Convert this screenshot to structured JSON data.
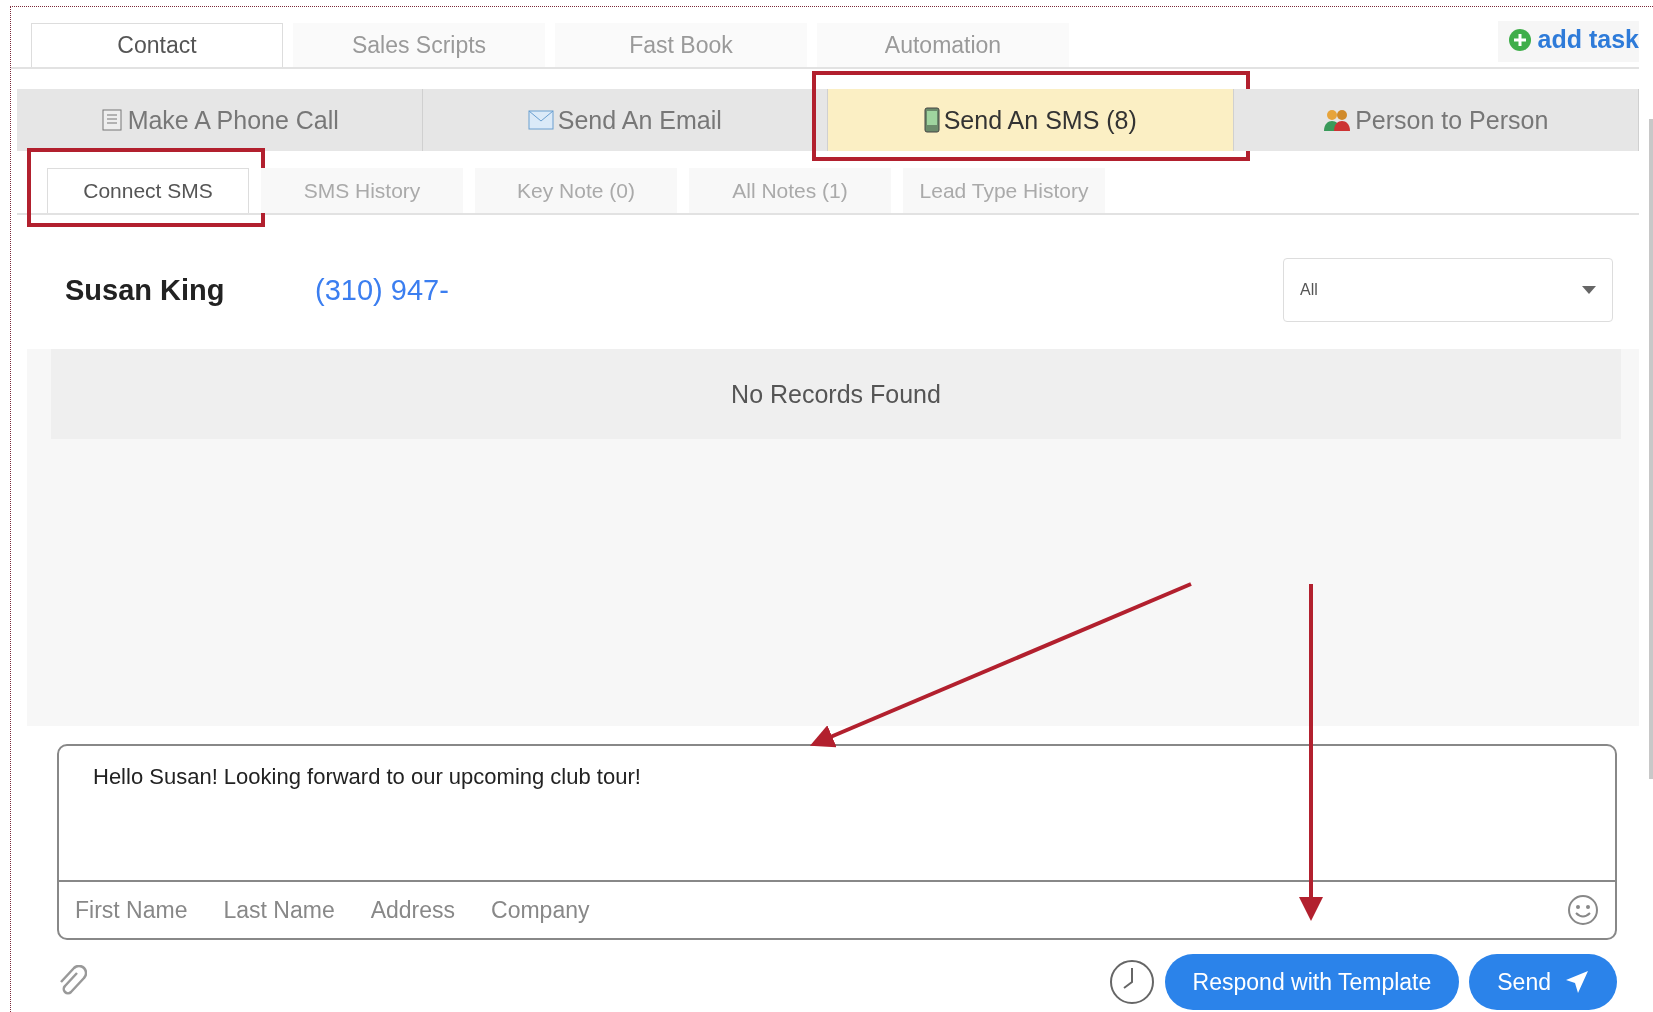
{
  "top_tabs": [
    {
      "label": "Contact",
      "selected": true
    },
    {
      "label": "Sales Scripts",
      "selected": false
    },
    {
      "label": "Fast Book",
      "selected": false
    },
    {
      "label": "Automation",
      "selected": false
    }
  ],
  "add_task": {
    "label": "add task"
  },
  "channel_tabs": [
    {
      "kind": "phone",
      "label": "Make A Phone Call",
      "selected": false,
      "annotated": false
    },
    {
      "kind": "email",
      "label": "Send An Email",
      "selected": false,
      "annotated": false
    },
    {
      "kind": "sms",
      "label": "Send An SMS (8)",
      "selected": true,
      "annotated": true
    },
    {
      "kind": "people",
      "label": "Person to Person",
      "selected": false,
      "annotated": false
    }
  ],
  "sub_tabs": [
    {
      "label": "Connect SMS",
      "selected": true,
      "annotated": true
    },
    {
      "label": "SMS History",
      "selected": false,
      "annotated": false
    },
    {
      "label": "Key Note (0)",
      "selected": false,
      "annotated": false
    },
    {
      "label": "All Notes (1)",
      "selected": false,
      "annotated": false
    },
    {
      "label": "Lead Type History",
      "selected": false,
      "annotated": false
    }
  ],
  "contact": {
    "name": "Susan King",
    "phone": "(310) 947-"
  },
  "filter": {
    "value": "All"
  },
  "empty_message": "No Records Found",
  "composer": {
    "value": "Hello Susan! Looking forward to our upcoming club tour!",
    "tokens": [
      "First Name",
      "Last Name",
      "Address",
      "Company"
    ]
  },
  "actions": {
    "template_button": "Respond with Template",
    "send_button": "Send"
  }
}
